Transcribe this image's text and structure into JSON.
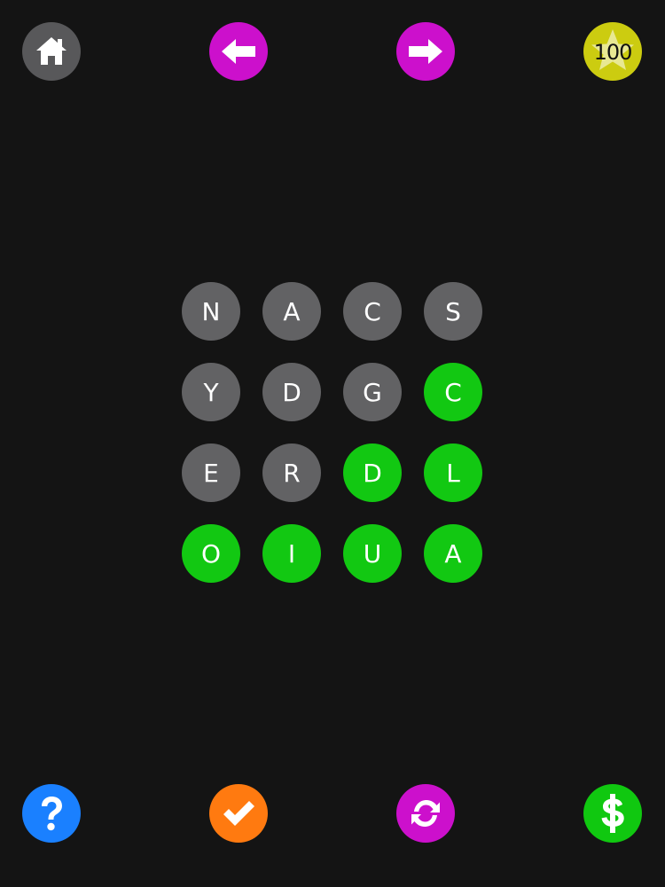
{
  "header": {
    "home_color": "#58585a",
    "prev_color": "#cc10cc",
    "next_color": "#cc10cc",
    "score_color": "#cccc10",
    "score_value": "100"
  },
  "footer": {
    "help_color": "#1a80ff",
    "check_color": "#ff7a10",
    "refresh_color": "#cc10cc",
    "coins_color": "#10c810"
  },
  "colors": {
    "tile_inactive": "#626264",
    "tile_active": "#12c812",
    "icon": "#ffffff"
  },
  "board": {
    "rows": 4,
    "cols": 4,
    "tiles": [
      {
        "letter": "N",
        "state": "inactive"
      },
      {
        "letter": "A",
        "state": "inactive"
      },
      {
        "letter": "C",
        "state": "inactive"
      },
      {
        "letter": "S",
        "state": "inactive"
      },
      {
        "letter": "Y",
        "state": "inactive"
      },
      {
        "letter": "D",
        "state": "inactive"
      },
      {
        "letter": "G",
        "state": "inactive"
      },
      {
        "letter": "C",
        "state": "active"
      },
      {
        "letter": "E",
        "state": "inactive"
      },
      {
        "letter": "R",
        "state": "inactive"
      },
      {
        "letter": "D",
        "state": "active"
      },
      {
        "letter": "L",
        "state": "active"
      },
      {
        "letter": "O",
        "state": "active"
      },
      {
        "letter": "I",
        "state": "active"
      },
      {
        "letter": "U",
        "state": "active"
      },
      {
        "letter": "A",
        "state": "active"
      }
    ]
  },
  "icons": {
    "home": "home-icon",
    "prev": "arrow-left-icon",
    "next": "arrow-right-icon",
    "score": "star-icon",
    "help": "question-icon",
    "check": "checkmark-icon",
    "refresh": "refresh-icon",
    "coins": "dollar-icon"
  }
}
